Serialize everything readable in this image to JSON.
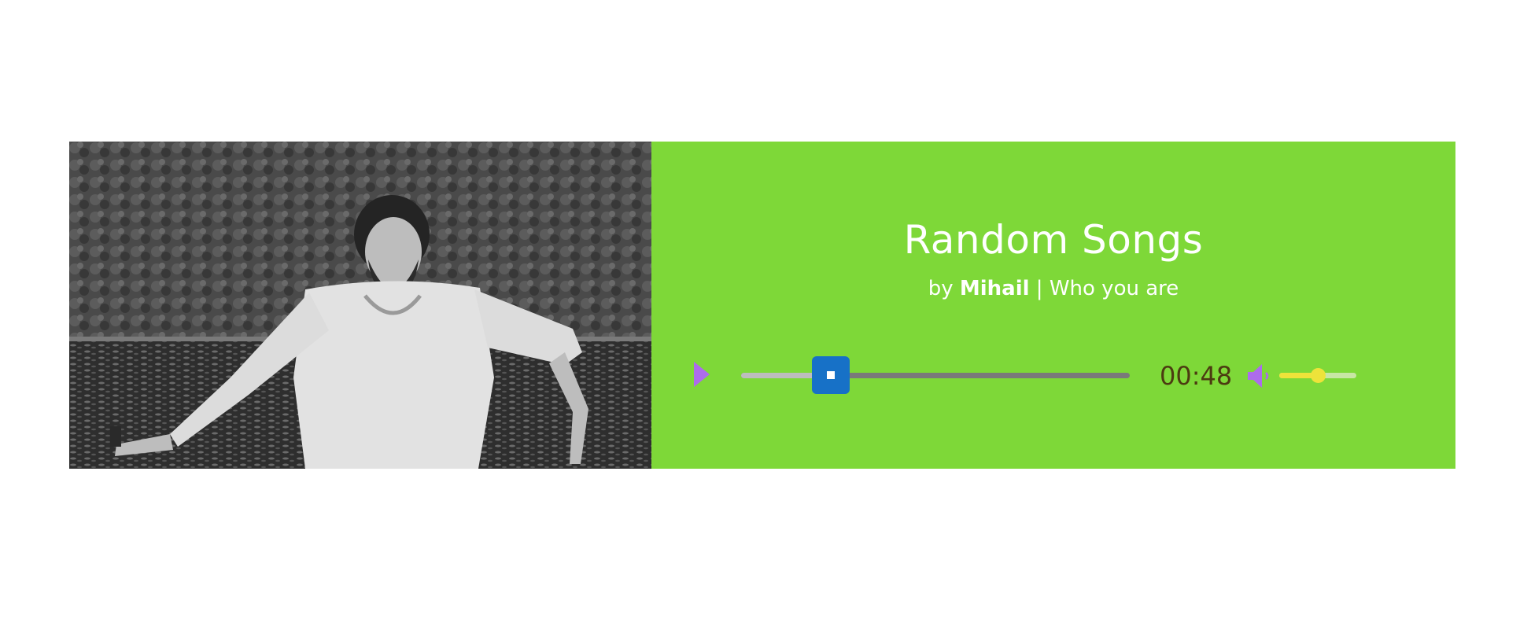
{
  "player": {
    "cover_image": "man-in-white-shirt-by-lake-photo",
    "title": "Random Songs",
    "subtitle": {
      "prefix": "by",
      "artist": "Mihail",
      "separator": "|",
      "song": "Who you are"
    },
    "controls": {
      "play_icon": "play-icon",
      "time": "00:48",
      "progress_fraction": 0.23,
      "volume_icon": "speaker-icon",
      "volume_fraction": 0.5
    }
  },
  "colors": {
    "panel_bg": "#7ed838",
    "play": "#ad6bec",
    "progress_thumb": "#1771c7",
    "time_text": "#4c3b11",
    "volume_accent": "#eee33a"
  }
}
